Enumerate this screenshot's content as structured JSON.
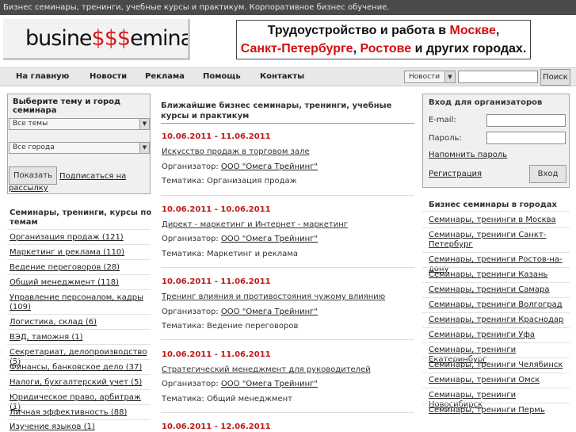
{
  "topbar": {
    "text": "Бизнес семинары, тренинги, учебные курсы и практикум. Корпоративное бизнес обучение."
  },
  "logo": {
    "part1": "busine",
    "dollars": "$$$",
    "part2": "eminar"
  },
  "banner": {
    "line1_a": "Трудоустройство и работа в ",
    "line1_b": "Москве",
    "line1_c": ",",
    "line2_a": "Санкт-Петербурге",
    "line2_b": ", ",
    "line2_c": "Ростове",
    "line2_d": " и других городах."
  },
  "nav": {
    "items": [
      "На главную",
      "Новости",
      "Реклама",
      "Помощь",
      "Контакты"
    ]
  },
  "search": {
    "select_value": "Новости",
    "button": "Поиск"
  },
  "filter": {
    "title": "Выберите тему и город семинара",
    "topic_value": "Все темы",
    "city_value": "Все города",
    "show_button": "Показать",
    "subscribe_link": "Подписаться на рассылку"
  },
  "categories": {
    "title": "Семинары, тренинги, курсы по темам",
    "items": [
      "Организация продаж (121)",
      "Маркетинг и реклама (110)",
      "Ведение переговоров (28)",
      "Общий менеджмент (118)",
      "Управление персоналом, кадры (109)",
      "Логистика, склад (6)",
      "ВЭД, таможня (1)",
      "Секретариат, делопроизводство (5)",
      "Финансы, банковское дело (37)",
      "Налоги, бухгалтерский учет (5)",
      "Юридическое право, арбитраж (1)",
      "Личная эффективность (88)",
      "Изучение языков (1)"
    ]
  },
  "main": {
    "title": "Ближайшие бизнес семинары, тренинги, учебные курсы и практикум",
    "organizer_label": "Организатор: ",
    "topic_label": "Тематика: ",
    "events": [
      {
        "date": "10.06.2011 - 11.06.2011",
        "title": "Искусство продаж в торговом зале",
        "organizer": "ООО \"Омега Трейнинг\"",
        "topic": "Организация продаж"
      },
      {
        "date": "10.06.2011 - 10.06.2011",
        "title": "Директ - маркетинг и Интернет - маркетинг",
        "organizer": "ООО \"Омега Трейнинг\"",
        "topic": "Маркетинг и реклама"
      },
      {
        "date": "10.06.2011 - 11.06.2011",
        "title": "Тренинг влияния и противостояния чужому влиянию",
        "organizer": "ООО \"Омега Трейнинг\"",
        "topic": "Ведение переговоров"
      },
      {
        "date": "10.06.2011 - 11.06.2011",
        "title": "Стратегический менеджмент для руководителей",
        "organizer": "ООО \"Омега Трейнинг\"",
        "topic": "Общий менеджмент"
      },
      {
        "date": "10.06.2011 - 12.06.2011"
      }
    ]
  },
  "login": {
    "title": "Вход для организаторов",
    "email_label": "E-mail:",
    "password_label": "Пароль:",
    "remind_link": "Напомнить пароль",
    "register_link": "Регистрация",
    "login_button": "Вход"
  },
  "cities": {
    "title": "Бизнес семинары в городах",
    "items": [
      "Семинары, тренинги в Москва",
      "Семинары, тренинги Санкт-Петербург",
      "Семинары, тренинги Ростов-на-дону",
      "Семинары, тренинги Казань",
      "Семинары, тренинги Самара",
      "Семинары, тренинги Волгоград",
      "Семинары, тренинги Краснодар",
      "Семинары, тренинги Уфа",
      "Семинары, тренинги Екатеринбург",
      "Семинары, тренинги Челябинск",
      "Семинары, тренинги Омск",
      "Семинары, тренинги Новосибирск",
      "Семинары, тренинги Пермь"
    ]
  }
}
